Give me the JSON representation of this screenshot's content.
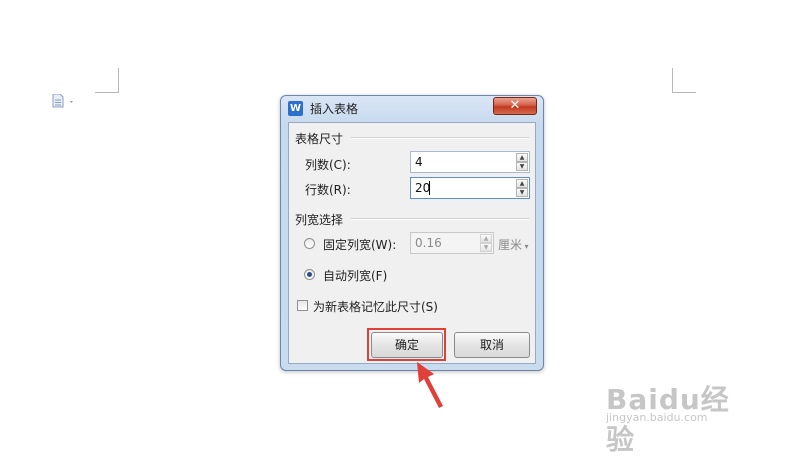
{
  "dialog": {
    "title": "插入表格",
    "app_icon_glyph": "W",
    "close_glyph": "✕",
    "table_size": {
      "section_title": "表格尺寸",
      "columns_label": "列数(C):",
      "columns_value": "4",
      "rows_label": "行数(R):",
      "rows_value": "20"
    },
    "column_width": {
      "section_title": "列宽选择",
      "fixed_label": "固定列宽(W):",
      "fixed_value": "0.16",
      "unit": "厘米",
      "auto_label": "自动列宽(F)",
      "selected": "auto"
    },
    "remember_label": "为新表格记忆此尺寸(S)",
    "remember_checked": false,
    "ok_label": "确定",
    "cancel_label": "取消"
  },
  "watermark": {
    "main": "Baidu经验",
    "sub": "jingyan.baidu.com"
  },
  "colors": {
    "highlight": "#e0403a",
    "arrow": "#e0403a",
    "dialog_frame": "#c7d9ee",
    "close_button": "#c0391f"
  }
}
